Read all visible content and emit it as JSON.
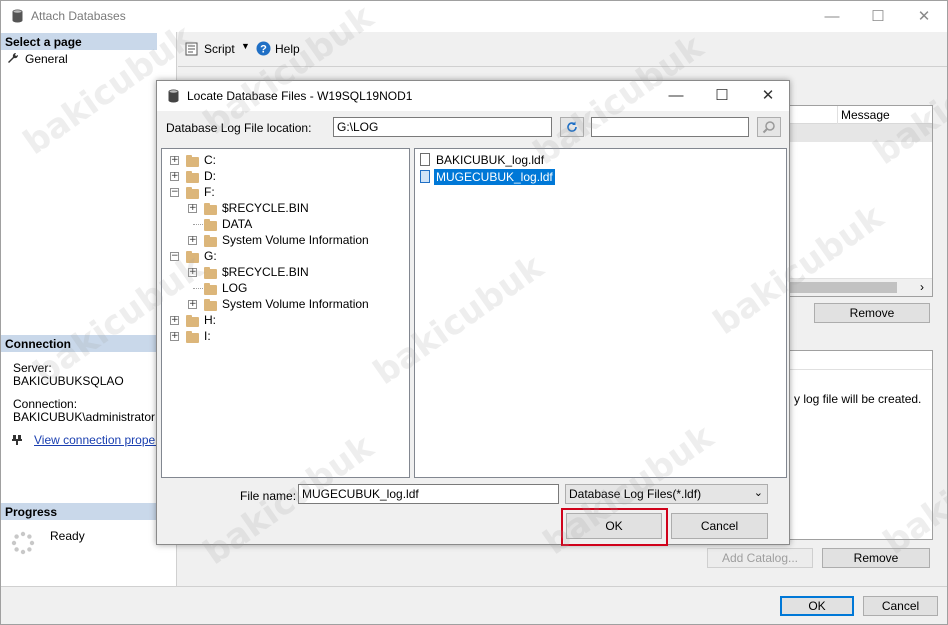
{
  "main_window": {
    "title": "Attach Databases",
    "controls": {
      "minimize": "—",
      "maximize": "☐",
      "close": "✕"
    }
  },
  "left_pane": {
    "select_page_header": "Select a page",
    "pages": [
      {
        "label": "General",
        "icon": "wrench-icon"
      }
    ],
    "connection_header": "Connection",
    "server_label": "Server:",
    "server_value": "BAKICUBUKSQLAO",
    "connection_label": "Connection:",
    "connection_value": "BAKICUBUK\\administrator",
    "view_connection_link": "View connection properties",
    "progress_header": "Progress",
    "progress_status": "Ready"
  },
  "toolbar": {
    "script_label": "Script",
    "help_label": "Help"
  },
  "content": {
    "message_column": "Message",
    "remove_label": "Remove",
    "details_note": "y log file will be created.",
    "add_catalog_label": "Add Catalog...",
    "remove2_label": "Remove"
  },
  "bottom_bar": {
    "ok_label": "OK",
    "cancel_label": "Cancel"
  },
  "dialog": {
    "title": "Locate Database Files - W19SQL19NOD1",
    "controls": {
      "minimize": "—",
      "maximize": "☐",
      "close": "✕"
    },
    "location_label": "Database Log File location:",
    "location_value": "G:\\LOG",
    "search_value": "",
    "tree": [
      {
        "label": "C:",
        "level": 0,
        "expander": "+",
        "folder": true
      },
      {
        "label": "D:",
        "level": 0,
        "expander": "+",
        "folder": true
      },
      {
        "label": "F:",
        "level": 0,
        "expander": "−",
        "folder": true
      },
      {
        "label": "$RECYCLE.BIN",
        "level": 1,
        "expander": "+",
        "folder": true
      },
      {
        "label": "DATA",
        "level": 1,
        "expander": "",
        "folder": true
      },
      {
        "label": "System Volume Information",
        "level": 1,
        "expander": "+",
        "folder": true
      },
      {
        "label": "G:",
        "level": 0,
        "expander": "−",
        "folder": true
      },
      {
        "label": "$RECYCLE.BIN",
        "level": 1,
        "expander": "+",
        "folder": true
      },
      {
        "label": "LOG",
        "level": 1,
        "expander": "",
        "folder": true
      },
      {
        "label": "System Volume Information",
        "level": 1,
        "expander": "+",
        "folder": true
      },
      {
        "label": "H:",
        "level": 0,
        "expander": "+",
        "folder": true
      },
      {
        "label": "I:",
        "level": 0,
        "expander": "+",
        "folder": true
      }
    ],
    "files": [
      {
        "name": "BAKICUBUK_log.ldf",
        "selected": false
      },
      {
        "name": "MUGECUBUK_log.ldf",
        "selected": true
      }
    ],
    "file_name_label": "File name:",
    "file_name_value": "MUGECUBUK_log.ldf",
    "file_type_value": "Database Log Files(*.ldf)",
    "ok_label": "OK",
    "cancel_label": "Cancel"
  },
  "watermark_text": "bakicubuk",
  "colors": {
    "accent": "#0078d7",
    "highlight_border": "#d0021b",
    "section_header": "#c9d8ea",
    "link": "#1a3fb0"
  }
}
